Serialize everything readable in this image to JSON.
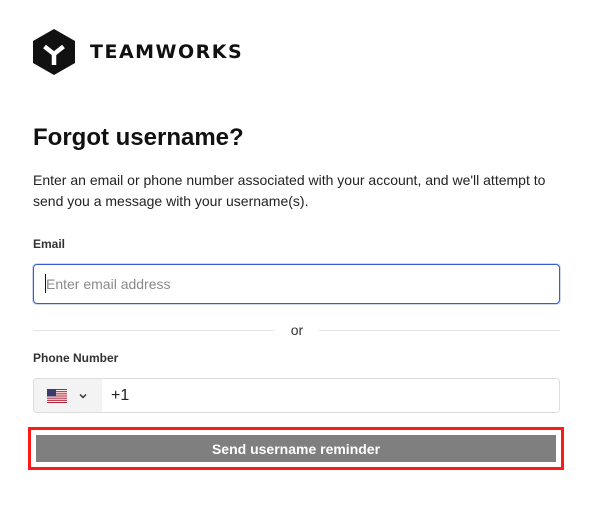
{
  "brand": {
    "name": "TEAMWORKS"
  },
  "page": {
    "title": "Forgot username?",
    "description": "Enter an email or phone number associated with your account, and we'll attempt to send you a message with your username(s)."
  },
  "email": {
    "label": "Email",
    "placeholder": "Enter email address",
    "value": ""
  },
  "divider": {
    "text": "or"
  },
  "phone": {
    "label": "Phone Number",
    "country_icon": "us-flag-icon",
    "dial_code": "+1"
  },
  "submit": {
    "label": "Send username reminder"
  },
  "colors": {
    "focus_border": "#3b5bd6",
    "button_bg": "#7f7f7f",
    "highlight_border": "#ff1a1a"
  }
}
